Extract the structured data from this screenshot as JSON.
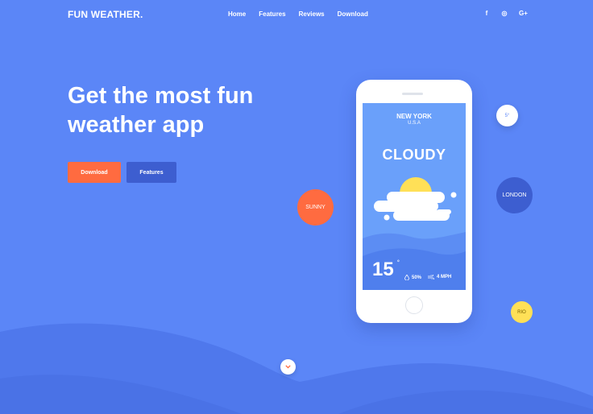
{
  "nav": {
    "brand": "FUN WEATHER.",
    "links": [
      "Home",
      "Features",
      "Reviews",
      "Download"
    ],
    "social": [
      {
        "icon": "facebook-icon",
        "glyph": "f"
      },
      {
        "icon": "instagram-icon",
        "glyph": "◎"
      },
      {
        "icon": "google-plus-icon",
        "glyph": "G+"
      }
    ]
  },
  "hero": {
    "title_line1": "Get the most fun",
    "title_line2": "weather app",
    "download_label": "Download",
    "features_label": "Features"
  },
  "phone_screen": {
    "city": "NEW YORK",
    "country": "U.S.A",
    "condition": "CLOUDY",
    "temperature": "15",
    "degree": "°",
    "humidity": "50%",
    "wind": "4 MPH"
  },
  "bubbles": {
    "sunny": "SUNNY",
    "temp": "5°",
    "london": "LONDON",
    "rio": "RIO"
  },
  "colors": {
    "background": "#5b86f7",
    "accent_orange": "#ff6b40",
    "accent_blue": "#3d5ed0",
    "sun_yellow": "#ffe057"
  },
  "icons": {
    "scroll": "chevron-down-icon",
    "humidity": "drop-icon",
    "wind": "wind-icon"
  }
}
